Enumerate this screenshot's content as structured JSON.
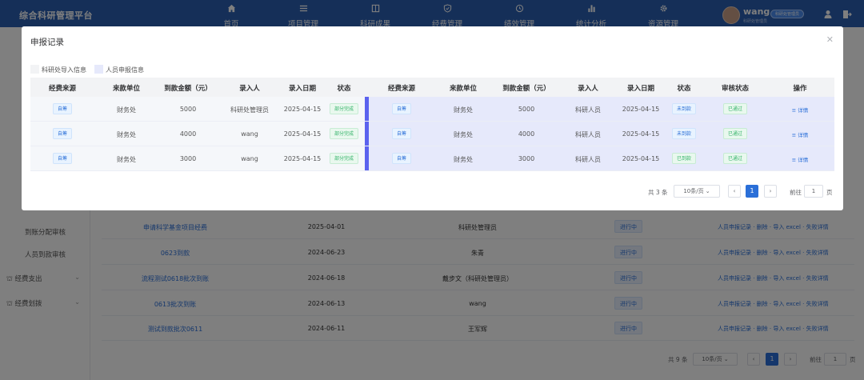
{
  "app": {
    "title": "综合科研管理平台"
  },
  "nav": [
    {
      "label": "首页",
      "icon": "home-icon"
    },
    {
      "label": "项目管理",
      "icon": "list-icon"
    },
    {
      "label": "科研成果",
      "icon": "book-icon"
    },
    {
      "label": "经费管理",
      "icon": "shield-icon"
    },
    {
      "label": "绩效管理",
      "icon": "history-icon"
    },
    {
      "label": "统计分析",
      "icon": "bar-chart-icon"
    },
    {
      "label": "资源管理",
      "icon": "gear-icon"
    }
  ],
  "user": {
    "name": "wang",
    "role": "科研处管理员",
    "sub": "科研处管理员"
  },
  "sidebar": {
    "items": [
      {
        "label": "到账分配审核"
      },
      {
        "label": "人员到款审核"
      }
    ],
    "groups": [
      {
        "label": "经费支出"
      },
      {
        "label": "经费划拨"
      }
    ]
  },
  "background_table": {
    "rows": [
      {
        "name": "申请科学基金项目经费",
        "date": "2025-04-01",
        "person": "科研处管理员",
        "status": "进行中"
      },
      {
        "name": "0623到款",
        "date": "2024-06-23",
        "person": "朱青",
        "status": "进行中"
      },
      {
        "name": "流程测试0618批次到账",
        "date": "2024-06-18",
        "person": "戴步文（科研处管理员）",
        "status": "进行中"
      },
      {
        "name": "0613批次到账",
        "date": "2024-06-13",
        "person": "wang",
        "status": "进行中"
      },
      {
        "name": "测试到款批次0611",
        "date": "2024-06-11",
        "person": "王军辉",
        "status": "进行中"
      }
    ],
    "actions": [
      "人员申报记录",
      "删除",
      "导入 excel",
      "失败详情"
    ],
    "pager": {
      "total": "共 9 条",
      "size": "10条/页",
      "page": "1",
      "goto": "前往",
      "goto_value": "1",
      "page_unit": "页"
    }
  },
  "modal": {
    "title": "申报记录",
    "legend": [
      {
        "label": "科研处导入信息",
        "color": "#f2f3f5"
      },
      {
        "label": "人员申报信息",
        "color": "#e6e9fb"
      }
    ],
    "headers": [
      "经费来源",
      "来款单位",
      "到款金额（元）",
      "录入人",
      "录入日期",
      "状态",
      "经费来源",
      "来款单位",
      "到款金额（元）",
      "录入人",
      "录入日期",
      "状态",
      "审核状态",
      "操作"
    ],
    "rows": [
      {
        "left": {
          "source": "自筹",
          "unit": "财务处",
          "amount": "5000",
          "entrant": "科研处管理员",
          "date": "2025-04-15",
          "status": "部分完成"
        },
        "right": {
          "source": "自筹",
          "unit": "财务处",
          "amount": "5000",
          "entrant": "科研人员",
          "date": "2025-04-15",
          "status": "未到款",
          "audit": "已通过",
          "action": "详情"
        }
      },
      {
        "left": {
          "source": "自筹",
          "unit": "财务处",
          "amount": "4000",
          "entrant": "wang",
          "date": "2025-04-15",
          "status": "部分完成"
        },
        "right": {
          "source": "自筹",
          "unit": "财务处",
          "amount": "4000",
          "entrant": "科研人员",
          "date": "2025-04-15",
          "status": "未到款",
          "audit": "已通过",
          "action": "详情"
        }
      },
      {
        "left": {
          "source": "自筹",
          "unit": "财务处",
          "amount": "3000",
          "entrant": "wang",
          "date": "2025-04-15",
          "status": "部分完成"
        },
        "right": {
          "source": "自筹",
          "unit": "财务处",
          "amount": "3000",
          "entrant": "科研人员",
          "date": "2025-04-15",
          "status": "已到款",
          "audit": "已通过",
          "action": "详情"
        }
      }
    ],
    "pager": {
      "total": "共 3 条",
      "size": "10条/页",
      "page": "1",
      "goto": "前往",
      "goto_value": "1",
      "page_unit": "页"
    }
  }
}
